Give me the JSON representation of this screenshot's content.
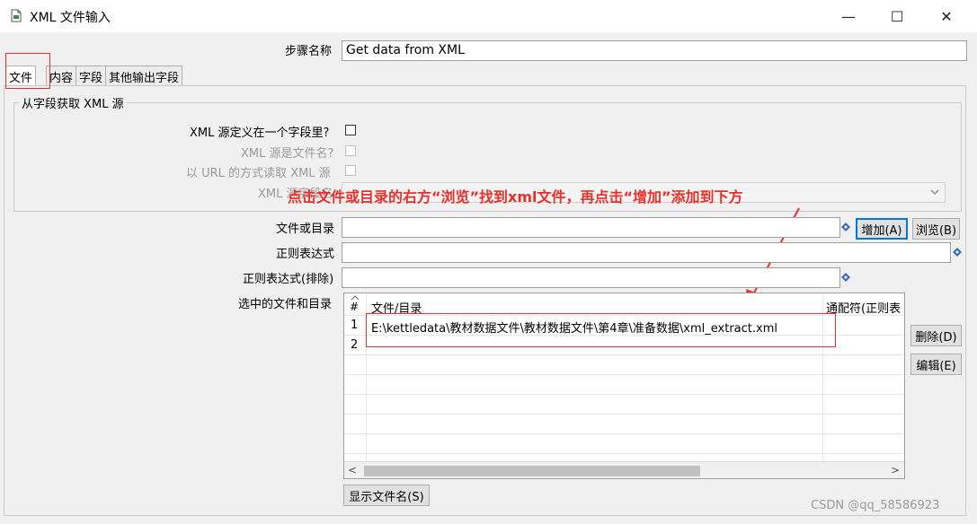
{
  "window": {
    "title": "XML 文件输入",
    "minimize": "—",
    "maximize": "☐",
    "close": "✕"
  },
  "step_name": {
    "label": "步骤名称",
    "value": "Get data from XML"
  },
  "tabs": [
    {
      "label": "文件",
      "active": true
    },
    {
      "label": "内容",
      "active": false
    },
    {
      "label": "字段",
      "active": false
    },
    {
      "label": "其他输出字段",
      "active": false
    }
  ],
  "xml_source_group": {
    "title": "从字段获取 XML 源",
    "defined_in_field": "XML 源定义在一个字段里?",
    "is_filename": "XML 源是文件名?",
    "read_as_url": "以 URL 的方式读取 XML 源",
    "field_name": "XML 源字段名"
  },
  "annotation": "点击文件或目录的右方“浏览”找到xml文件，再点击“增加”添加到下方",
  "file_or_dir": {
    "label": "文件或目录",
    "value": ""
  },
  "regex": {
    "label": "正则表达式",
    "value": ""
  },
  "regex_exclude": {
    "label": "正则表达式(排除)",
    "value": ""
  },
  "buttons": {
    "add": "增加(A)",
    "browse": "浏览(B)",
    "delete": "删除(D)",
    "edit": "编辑(E)",
    "show_filenames": "显示文件名(S)"
  },
  "selected_files": {
    "label": "选中的文件和目录",
    "columns": [
      "#",
      "文件/目录",
      "通配符(正则表"
    ],
    "rows": [
      {
        "num": "1",
        "path": "E:\\kettledata\\教材数据文件\\教材数据文件\\第4章\\准备数据\\xml_extract.xml",
        "wildcard": ""
      },
      {
        "num": "2",
        "path": "",
        "wildcard": ""
      }
    ]
  },
  "watermark": "CSDN @qq_58586923",
  "colors": {
    "annotation_red": "#e8302a",
    "focus_blue": "#0078d7"
  }
}
